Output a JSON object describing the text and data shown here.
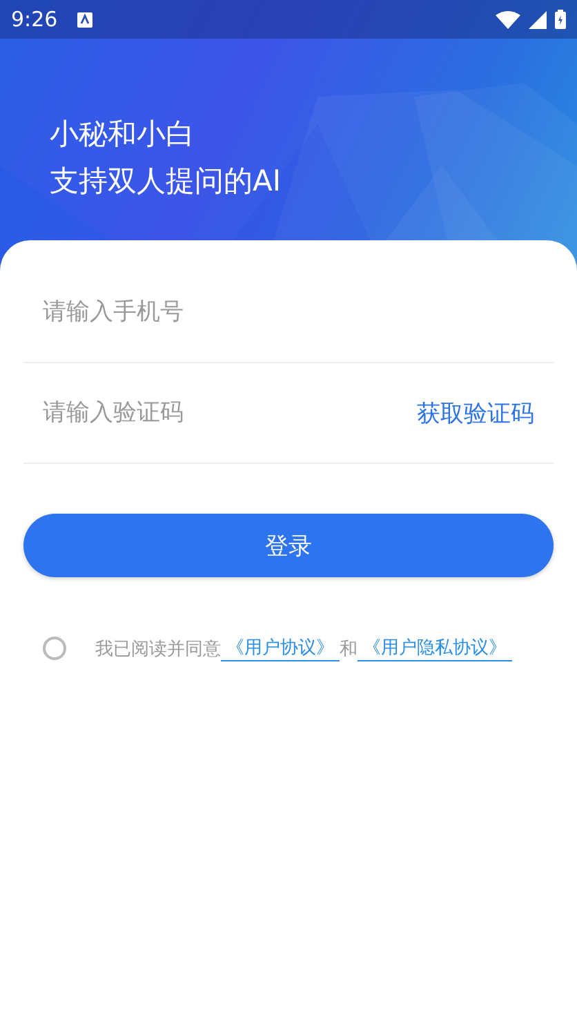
{
  "status_bar": {
    "time": "9:26"
  },
  "headline": [
    "小秘和小白",
    "支持双人提问的AI"
  ],
  "phone_field": {
    "placeholder": "请输入手机号"
  },
  "code_field": {
    "placeholder": "请输入验证码",
    "action": "获取验证码"
  },
  "login_button": "登录",
  "agreement": {
    "checked": false,
    "parts": [
      {
        "kind": "text",
        "text": "我已阅读并同意"
      },
      {
        "kind": "link",
        "text": "《用户协议》"
      },
      {
        "kind": "text",
        "text": "和"
      },
      {
        "kind": "link",
        "text": "《用户隐私协议》"
      }
    ]
  }
}
